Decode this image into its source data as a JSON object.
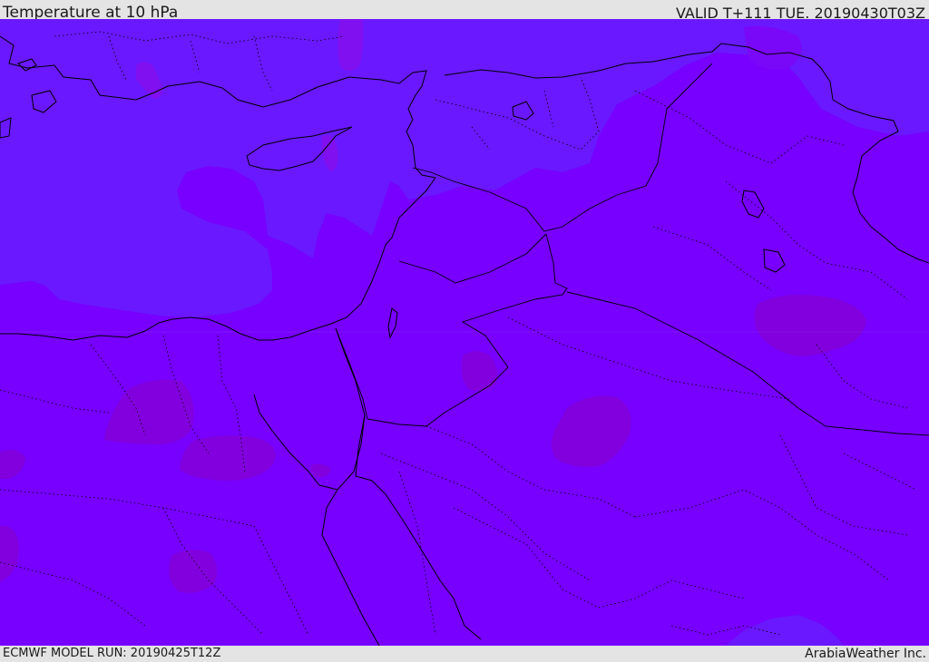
{
  "header": {
    "title": "Temperature at 10 hPa",
    "valid_time": "VALID T+111 TUE. 20190430T03Z"
  },
  "footer": {
    "model_run": "ECMWF MODEL RUN: 20190425T12Z",
    "credit": "ArabiaWeather Inc."
  },
  "colors": {
    "base_field": "#7700ff",
    "colder_field": "#6a18ff",
    "warmer_blob": "#8200dd",
    "magenta_patch": "#8010f0",
    "coastline": "#000000",
    "chrome": "#e4e4e4"
  }
}
